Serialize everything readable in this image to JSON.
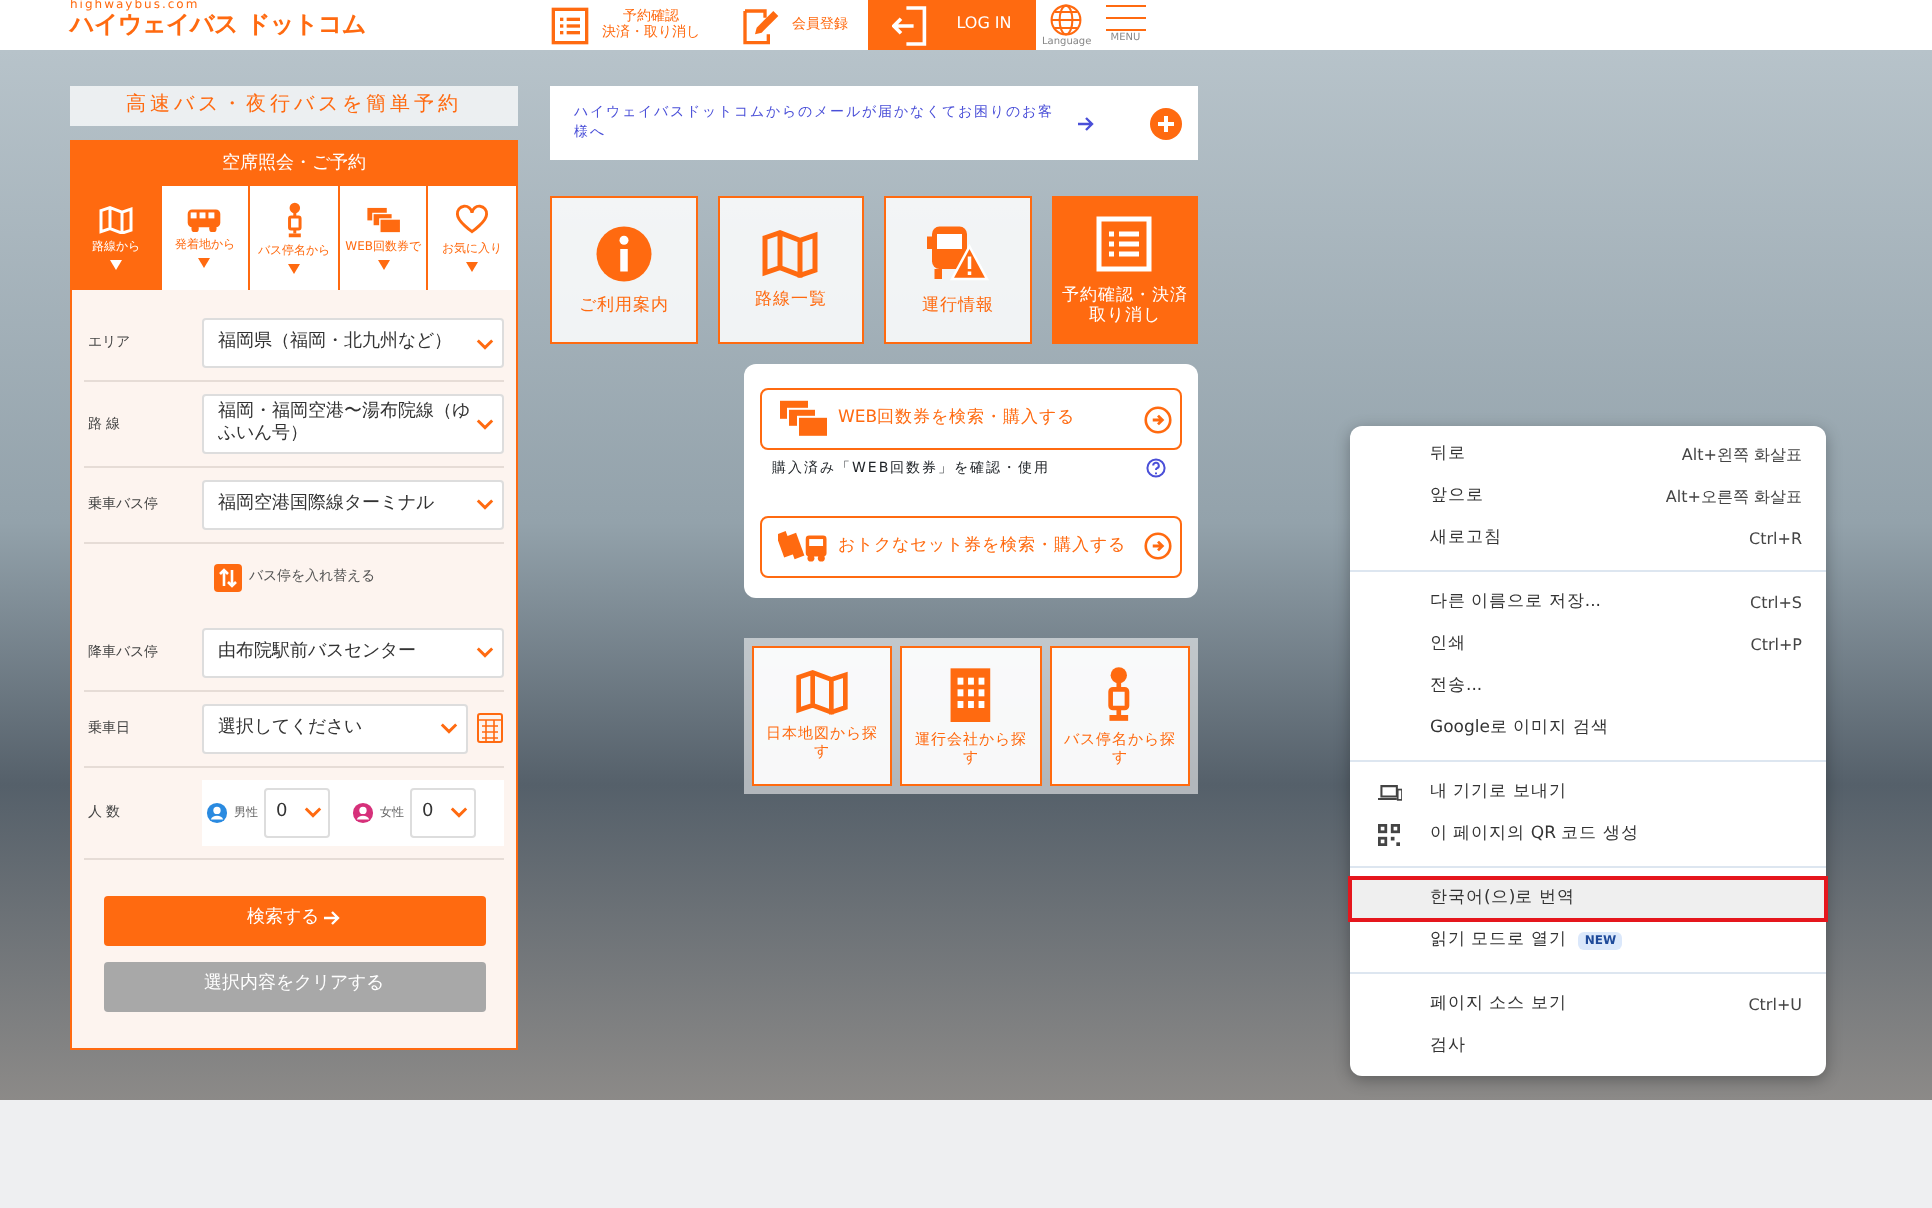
{
  "header": {
    "logo_sub": "highwaybus.com",
    "logo": "ハイウェイバス ドットコム",
    "nav": [
      {
        "kind": "reserve",
        "lines": [
          "予約確認",
          "決済・取り消し"
        ]
      },
      {
        "kind": "member",
        "lines": [
          "会員登録"
        ]
      },
      {
        "kind": "login",
        "lines": [
          "LOG IN"
        ]
      },
      {
        "kind": "language",
        "lines": [
          "Language"
        ]
      },
      {
        "kind": "menu",
        "lines": [
          "MENU"
        ]
      }
    ]
  },
  "booking": {
    "banner": "高速バス・夜行バスを簡単予約",
    "title": "空席照会・ご予約",
    "tabs": [
      {
        "kind": "map",
        "label": "路線から",
        "selected": true
      },
      {
        "kind": "bus",
        "label": "発着地から",
        "selected": false
      },
      {
        "kind": "stop",
        "label": "バス停名から",
        "selected": false
      },
      {
        "kind": "tickets",
        "label": "WEB回数券で",
        "selected": false
      },
      {
        "kind": "heart",
        "label": "お気に入り",
        "selected": false
      }
    ],
    "fields": [
      {
        "kind": "select",
        "label": "エリア",
        "value": "福岡県（福岡・北九州など）"
      },
      {
        "kind": "select",
        "label": "路 線",
        "value": "福岡・福岡空港〜湯布院線（ゆふいん号）"
      },
      {
        "kind": "select",
        "label": "乗車バス停",
        "value": "福岡空港国際線ターミナル"
      },
      {
        "kind": "swap",
        "label": "バス停を入れ替える"
      },
      {
        "kind": "select",
        "label": "降車バス停",
        "value": "由布院駅前バスセンター"
      },
      {
        "kind": "date",
        "label": "乗車日",
        "value": "選択してください"
      },
      {
        "kind": "people",
        "label": "人 数",
        "groups": [
          {
            "kind": "male",
            "label": "男性",
            "value": "0"
          },
          {
            "kind": "female",
            "label": "女性",
            "value": "0"
          }
        ]
      }
    ],
    "search_button": "検索する",
    "clear_button": {
      "label": "選択内容をクリアする",
      "disabled": true
    }
  },
  "notice": "ハイウェイバスドットコムからのメールが届かなくてお困りのお客様へ",
  "tiles": [
    {
      "kind": "info",
      "label": "ご利用案内",
      "selected": false
    },
    {
      "kind": "map",
      "label": "路線一覧",
      "selected": false
    },
    {
      "kind": "alert",
      "label": "運行情報",
      "selected": false
    },
    {
      "kind": "list",
      "label": "予約確認・決済取り消し",
      "selected": true
    }
  ],
  "tickets": {
    "web_button": "WEB回数券を検索・購入する",
    "used_link": "購入済み「WEB回数券」を確認・使用",
    "set_button": "おトクなセット券を検索・購入する"
  },
  "search_tiles": [
    {
      "kind": "map",
      "label": "日本地図から探す"
    },
    {
      "kind": "building",
      "label": "運行会社から探す"
    },
    {
      "kind": "stop",
      "label": "バス停名から探す"
    }
  ],
  "context_menu": {
    "groups": [
      [
        {
          "label": "뒤로",
          "shortcut": "Alt+왼쪽 화살표",
          "selected": false
        },
        {
          "label": "앞으로",
          "shortcut": "Alt+오른쪽 화살표",
          "selected": false
        },
        {
          "label": "새로고침",
          "shortcut": "Ctrl+R",
          "selected": false
        }
      ],
      [
        {
          "label": "다른 이름으로 저장...",
          "shortcut": "Ctrl+S",
          "selected": false
        },
        {
          "label": "인쇄",
          "shortcut": "Ctrl+P",
          "selected": false
        },
        {
          "label": "전송...",
          "selected": false
        },
        {
          "label": "Google로 이미지 검색",
          "selected": false
        }
      ],
      [
        {
          "label": "내 기기로 보내기",
          "kind": "device",
          "selected": false
        },
        {
          "label": "이 페이지의 QR 코드 생성",
          "kind": "qr",
          "selected": false
        }
      ],
      [
        {
          "label": "한국어(으)로 번역",
          "selected": true
        },
        {
          "label": "읽기 모드로 열기",
          "badge": "NEW",
          "selected": false
        }
      ],
      [
        {
          "label": "페이지 소스 보기",
          "shortcut": "Ctrl+U",
          "selected": false
        },
        {
          "label": "검사",
          "selected": false
        }
      ]
    ]
  }
}
